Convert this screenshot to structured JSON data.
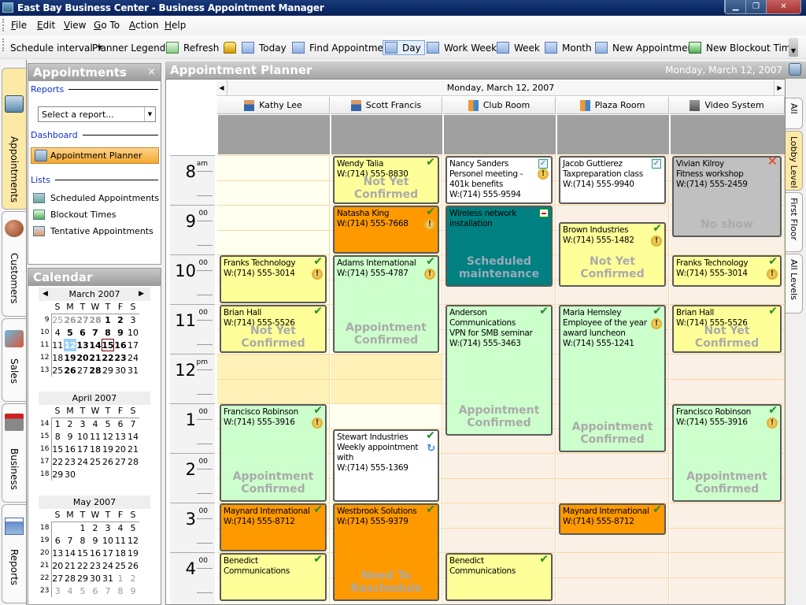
{
  "window": {
    "title": "East Bay Business Center - Business Appointment Manager",
    "controls": [
      "minimize",
      "restore",
      "close"
    ]
  },
  "menu": [
    "File",
    "Edit",
    "View",
    "Go To",
    "Action",
    "Help"
  ],
  "toolbar": {
    "schedule_interval": "Schedule interval",
    "planner_legend": "Planner Legend",
    "refresh": "Refresh",
    "lock_icon": "lock-icon",
    "today": "Today",
    "find": "Find Appointment",
    "day": "Day",
    "work_week": "Work Week",
    "week": "Week",
    "month": "Month",
    "new_appointment": "New Appointment",
    "new_blockout": "New Blockout Time"
  },
  "left_tabs": [
    "Appointments",
    "Customers",
    "Sales",
    "Business",
    "Reports"
  ],
  "appointments_panel": {
    "title": "Appointments",
    "close": "×",
    "reports_label": "Reports",
    "report_placeholder": "Select a report...",
    "dashboard_label": "Dashboard",
    "dashboard_item": "Appointment Planner",
    "lists_label": "Lists",
    "lists": [
      "Scheduled Appointments",
      "Blockout Times",
      "Tentative Appointments"
    ]
  },
  "calendar_panel": {
    "title": "Calendar",
    "dow": [
      "S",
      "M",
      "T",
      "W",
      "T",
      "F",
      "S"
    ],
    "months": [
      {
        "name": "March 2007",
        "weeks": [
          {
            "wk": "9",
            "days": [
              [
                "25",
                "g"
              ],
              [
                "26",
                "gb"
              ],
              [
                "27",
                "gb"
              ],
              [
                "28",
                "gb"
              ],
              [
                "1",
                "b"
              ],
              [
                "2",
                "b"
              ],
              [
                "3",
                ""
              ]
            ]
          },
          {
            "wk": "10",
            "days": [
              [
                "4",
                ""
              ],
              [
                "5",
                "b"
              ],
              [
                "6",
                "b"
              ],
              [
                "7",
                "b"
              ],
              [
                "8",
                "b"
              ],
              [
                "9",
                "b"
              ],
              [
                "10",
                ""
              ]
            ]
          },
          {
            "wk": "11",
            "days": [
              [
                "11",
                ""
              ],
              [
                "12",
                "sel"
              ],
              [
                "13",
                "b"
              ],
              [
                "14",
                "b"
              ],
              [
                "15",
                "today"
              ],
              [
                "16",
                "b"
              ],
              [
                "17",
                ""
              ]
            ]
          },
          {
            "wk": "12",
            "days": [
              [
                "18",
                ""
              ],
              [
                "19",
                "b"
              ],
              [
                "20",
                "b"
              ],
              [
                "21",
                "b"
              ],
              [
                "22",
                "b"
              ],
              [
                "23",
                "b"
              ],
              [
                "24",
                ""
              ]
            ]
          },
          {
            "wk": "13",
            "days": [
              [
                "25",
                ""
              ],
              [
                "26",
                "b"
              ],
              [
                "27",
                ""
              ],
              [
                "28",
                "b"
              ],
              [
                "29",
                ""
              ],
              [
                "30",
                ""
              ],
              [
                "31",
                ""
              ]
            ]
          }
        ]
      },
      {
        "name": "April 2007",
        "weeks": [
          {
            "wk": "14",
            "days": [
              [
                "1",
                ""
              ],
              [
                "2",
                ""
              ],
              [
                "3",
                ""
              ],
              [
                "4",
                ""
              ],
              [
                "5",
                ""
              ],
              [
                "6",
                ""
              ],
              [
                "7",
                ""
              ]
            ]
          },
          {
            "wk": "15",
            "days": [
              [
                "8",
                ""
              ],
              [
                "9",
                ""
              ],
              [
                "10",
                ""
              ],
              [
                "11",
                ""
              ],
              [
                "12",
                ""
              ],
              [
                "13",
                ""
              ],
              [
                "14",
                ""
              ]
            ]
          },
          {
            "wk": "16",
            "days": [
              [
                "15",
                ""
              ],
              [
                "16",
                ""
              ],
              [
                "17",
                ""
              ],
              [
                "18",
                ""
              ],
              [
                "19",
                ""
              ],
              [
                "20",
                ""
              ],
              [
                "21",
                ""
              ]
            ]
          },
          {
            "wk": "17",
            "days": [
              [
                "22",
                ""
              ],
              [
                "23",
                ""
              ],
              [
                "24",
                ""
              ],
              [
                "25",
                ""
              ],
              [
                "26",
                ""
              ],
              [
                "27",
                ""
              ],
              [
                "28",
                ""
              ]
            ]
          },
          {
            "wk": "18",
            "days": [
              [
                "29",
                ""
              ],
              [
                "30",
                ""
              ],
              [
                "",
                ""
              ],
              [
                "",
                ""
              ],
              [
                "",
                ""
              ],
              [
                "",
                ""
              ],
              [
                "",
                ""
              ]
            ]
          }
        ]
      },
      {
        "name": "May 2007",
        "weeks": [
          {
            "wk": "18",
            "days": [
              [
                "",
                ""
              ],
              [
                "",
                ""
              ],
              [
                "1",
                ""
              ],
              [
                "2",
                ""
              ],
              [
                "3",
                ""
              ],
              [
                "4",
                ""
              ],
              [
                "5",
                ""
              ]
            ]
          },
          {
            "wk": "19",
            "days": [
              [
                "6",
                ""
              ],
              [
                "7",
                ""
              ],
              [
                "8",
                ""
              ],
              [
                "9",
                ""
              ],
              [
                "10",
                ""
              ],
              [
                "11",
                ""
              ],
              [
                "12",
                ""
              ]
            ]
          },
          {
            "wk": "20",
            "days": [
              [
                "13",
                ""
              ],
              [
                "14",
                ""
              ],
              [
                "15",
                ""
              ],
              [
                "16",
                ""
              ],
              [
                "17",
                ""
              ],
              [
                "18",
                ""
              ],
              [
                "19",
                ""
              ]
            ]
          },
          {
            "wk": "21",
            "days": [
              [
                "20",
                ""
              ],
              [
                "21",
                ""
              ],
              [
                "22",
                ""
              ],
              [
                "23",
                ""
              ],
              [
                "24",
                ""
              ],
              [
                "25",
                ""
              ],
              [
                "26",
                ""
              ]
            ]
          },
          {
            "wk": "22",
            "days": [
              [
                "27",
                ""
              ],
              [
                "28",
                ""
              ],
              [
                "29",
                ""
              ],
              [
                "30",
                ""
              ],
              [
                "31",
                ""
              ],
              [
                "1",
                "g"
              ],
              [
                "2",
                "g"
              ]
            ]
          },
          {
            "wk": "23",
            "days": [
              [
                "3",
                "g"
              ],
              [
                "4",
                "g"
              ],
              [
                "5",
                "g"
              ],
              [
                "6",
                "g"
              ],
              [
                "7",
                "g"
              ],
              [
                "8",
                "g"
              ],
              [
                "9",
                "g"
              ]
            ]
          }
        ]
      }
    ]
  },
  "planner": {
    "title": "Appointment Planner",
    "header_date": "Monday, March 12, 2007",
    "date_bar": "Monday, March 12, 2007",
    "resources": [
      {
        "name": "Kathy Lee",
        "icon": "person-icon"
      },
      {
        "name": "Scott Francis",
        "icon": "person-icon"
      },
      {
        "name": "Club Room",
        "icon": "door-icon"
      },
      {
        "name": "Plaza Room",
        "icon": "door-icon"
      },
      {
        "name": "Video System",
        "icon": "camera-icon"
      }
    ],
    "hours": [
      {
        "h": "8",
        "m": "am"
      },
      {
        "h": "9",
        "m": "00"
      },
      {
        "h": "10",
        "m": "00"
      },
      {
        "h": "11",
        "m": "00"
      },
      {
        "h": "12",
        "m": "pm"
      },
      {
        "h": "1",
        "m": "00"
      },
      {
        "h": "2",
        "m": "00"
      },
      {
        "h": "3",
        "m": "00"
      },
      {
        "h": "4",
        "m": "00"
      }
    ],
    "right_tabs": [
      "All",
      "Lobby Level",
      "First Floor",
      "All Levels"
    ],
    "appointments": [
      {
        "col": 0,
        "start": 10.0,
        "end": 11.0,
        "color": "yellow",
        "lines": [
          "Franks Technology",
          "W:(714) 555-3014"
        ],
        "status": "",
        "icons": [
          "check",
          "alert"
        ]
      },
      {
        "col": 0,
        "start": 11.0,
        "end": 12.0,
        "color": "yellow",
        "lines": [
          "Brian Hall",
          "W:(714) 555-5526"
        ],
        "status": "Not Yet Confirmed",
        "icons": [
          "check"
        ]
      },
      {
        "col": 0,
        "start": 13.0,
        "end": 15.0,
        "color": "green",
        "lines": [
          "Francisco Robinson",
          "W:(714) 555-3916"
        ],
        "status": "Appointment Confirmed",
        "icons": [
          "check",
          "alert"
        ]
      },
      {
        "col": 0,
        "start": 15.0,
        "end": 16.0,
        "color": "orange",
        "lines": [
          "Maynard International",
          "W:(714) 555-8712"
        ],
        "status": "",
        "icons": [
          "check"
        ]
      },
      {
        "col": 0,
        "start": 16.0,
        "end": 17.0,
        "color": "yellow",
        "lines": [
          "Benedict",
          "Communications"
        ],
        "status": "",
        "icons": [
          "check"
        ]
      },
      {
        "col": 1,
        "start": 8.0,
        "end": 9.0,
        "color": "yellow",
        "lines": [
          "Wendy Talia",
          "W:(714) 555-8830"
        ],
        "status": "Not Yet Confirmed",
        "icons": [
          "check"
        ]
      },
      {
        "col": 1,
        "start": 9.0,
        "end": 10.0,
        "color": "orange",
        "lines": [
          "Natasha King",
          "W:(714) 555-7668"
        ],
        "status": "",
        "icons": [
          "check",
          "alert"
        ]
      },
      {
        "col": 1,
        "start": 10.0,
        "end": 12.0,
        "color": "green",
        "lines": [
          "Adams International",
          "W:(714) 555-4787"
        ],
        "status": "Appointment Confirmed",
        "icons": [
          "check",
          "alert"
        ]
      },
      {
        "col": 1,
        "start": 13.5,
        "end": 15.0,
        "color": "white",
        "lines": [
          "Stewart Industries",
          "Weekly appointment",
          "with",
          "W:(714) 555-1369"
        ],
        "status": "",
        "icons": [
          "check",
          "recur"
        ]
      },
      {
        "col": 1,
        "start": 15.0,
        "end": 17.0,
        "color": "orange",
        "lines": [
          "Westbrook Solutions",
          "W:(714) 555-9379"
        ],
        "status": "Need To Reschedule",
        "icons": [
          "check"
        ]
      },
      {
        "col": 2,
        "start": 8.0,
        "end": 9.0,
        "color": "white",
        "lines": [
          "Nancy Sanders",
          "Personel meeting -",
          "401k benefits",
          "W:(714) 555-9594"
        ],
        "status": "",
        "icons": [
          "checkbox",
          "alert"
        ]
      },
      {
        "col": 2,
        "start": 9.0,
        "end": 10.67,
        "color": "teal",
        "lines": [
          "Wireless network",
          "installation"
        ],
        "status": "Scheduled maintenance",
        "icons": [
          "blockout"
        ]
      },
      {
        "col": 2,
        "start": 11.0,
        "end": 13.67,
        "color": "green",
        "lines": [
          "Anderson",
          "Communications",
          "VPN for SMB seminar",
          "W:(714) 555-3463"
        ],
        "status": "Appointment Confirmed",
        "icons": [
          "check"
        ]
      },
      {
        "col": 2,
        "start": 16.0,
        "end": 17.0,
        "color": "yellow",
        "lines": [
          "Benedict",
          "Communications"
        ],
        "status": "",
        "icons": [
          "check"
        ]
      },
      {
        "col": 3,
        "start": 8.0,
        "end": 9.0,
        "color": "white",
        "lines": [
          "Jacob Guttierez",
          "Taxpreparation class",
          "W:(714) 555-9940"
        ],
        "status": "",
        "icons": [
          "checkbox"
        ]
      },
      {
        "col": 3,
        "start": 9.33,
        "end": 10.67,
        "color": "yellow",
        "lines": [
          "Brown Industries",
          "W:(714) 555-1482"
        ],
        "status": "Not Yet Confirmed",
        "icons": [
          "check",
          "alert"
        ]
      },
      {
        "col": 3,
        "start": 11.0,
        "end": 14.0,
        "color": "green",
        "lines": [
          "Maria Hemsley",
          "Employee of the year",
          "award luncheon",
          "W:(714) 555-1241"
        ],
        "status": "Appointment Confirmed",
        "icons": [
          "check",
          "alert"
        ]
      },
      {
        "col": 3,
        "start": 15.0,
        "end": 15.67,
        "color": "orange",
        "lines": [
          "Maynard International",
          "W:(714) 555-8712"
        ],
        "status": "",
        "icons": [
          "check"
        ]
      },
      {
        "col": 4,
        "start": 8.0,
        "end": 9.67,
        "color": "gray",
        "lines": [
          "Vivian Kilroy",
          "Fitness workshop",
          "W:(714) 555-2459"
        ],
        "status": "No show",
        "icons": [
          "x"
        ]
      },
      {
        "col": 4,
        "start": 10.0,
        "end": 10.67,
        "color": "yellow",
        "lines": [
          "Franks Technology",
          "W:(714) 555-3014"
        ],
        "status": "",
        "icons": [
          "check",
          "alert"
        ]
      },
      {
        "col": 4,
        "start": 11.0,
        "end": 12.0,
        "color": "yellow",
        "lines": [
          "Brian Hall",
          "W:(714) 555-5526"
        ],
        "status": "Not Yet Confirmed",
        "icons": [
          "check"
        ]
      },
      {
        "col": 4,
        "start": 13.0,
        "end": 15.0,
        "color": "green",
        "lines": [
          "Francisco Robinson",
          "W:(714) 555-3916"
        ],
        "status": "Appointment Confirmed",
        "icons": [
          "check",
          "alert"
        ]
      }
    ]
  }
}
